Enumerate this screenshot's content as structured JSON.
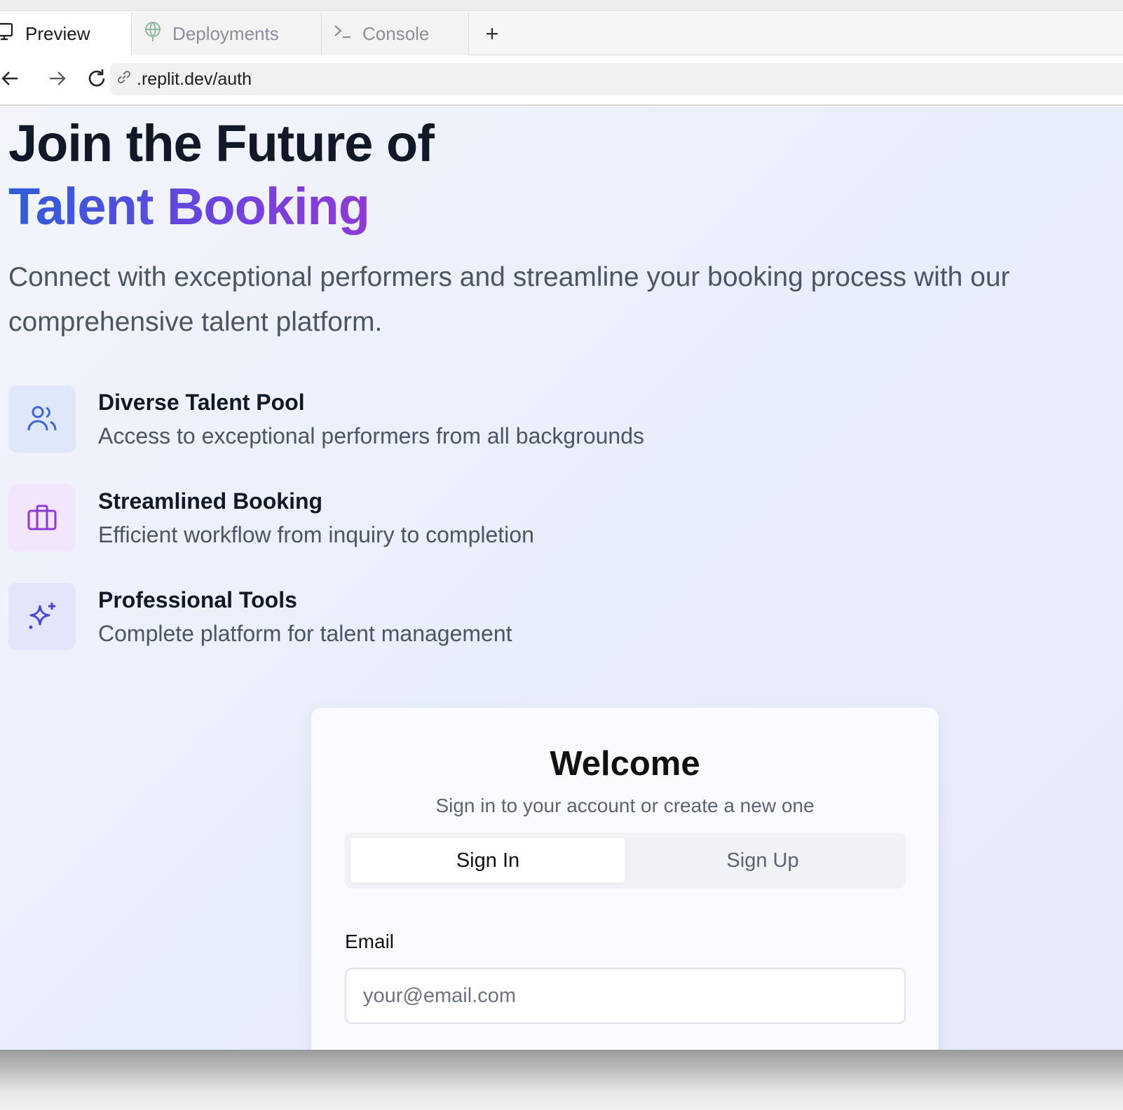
{
  "browser": {
    "tabs": [
      {
        "label": "Preview",
        "icon": "monitor-icon"
      },
      {
        "label": "Deployments",
        "icon": "deployments-icon"
      },
      {
        "label": "Console",
        "icon": "terminal-icon"
      }
    ],
    "new_tab_label": "+",
    "url": ".replit.dev/auth"
  },
  "hero": {
    "title_line1": "Join the Future of",
    "title_line2": "Talent Booking",
    "description": "Connect with exceptional performers and streamline your booking process with our comprehensive talent platform."
  },
  "features": [
    {
      "title": "Diverse Talent Pool",
      "description": "Access to exceptional performers from all backgrounds",
      "icon": "users-icon"
    },
    {
      "title": "Streamlined Booking",
      "description": "Efficient workflow from inquiry to completion",
      "icon": "briefcase-icon"
    },
    {
      "title": "Professional Tools",
      "description": "Complete platform for talent management",
      "icon": "sparkles-icon"
    }
  ],
  "auth": {
    "title": "Welcome",
    "subtitle": "Sign in to your account or create a new one",
    "tabs": [
      "Sign In",
      "Sign Up"
    ],
    "active_tab": "Sign In",
    "email_label": "Email",
    "email_placeholder": "your@email.com",
    "email_value": ""
  },
  "colors": {
    "gradient_start": "#2e5ed9",
    "gradient_end": "#8f3ad6",
    "heading": "#111827",
    "muted": "#4b5563"
  }
}
